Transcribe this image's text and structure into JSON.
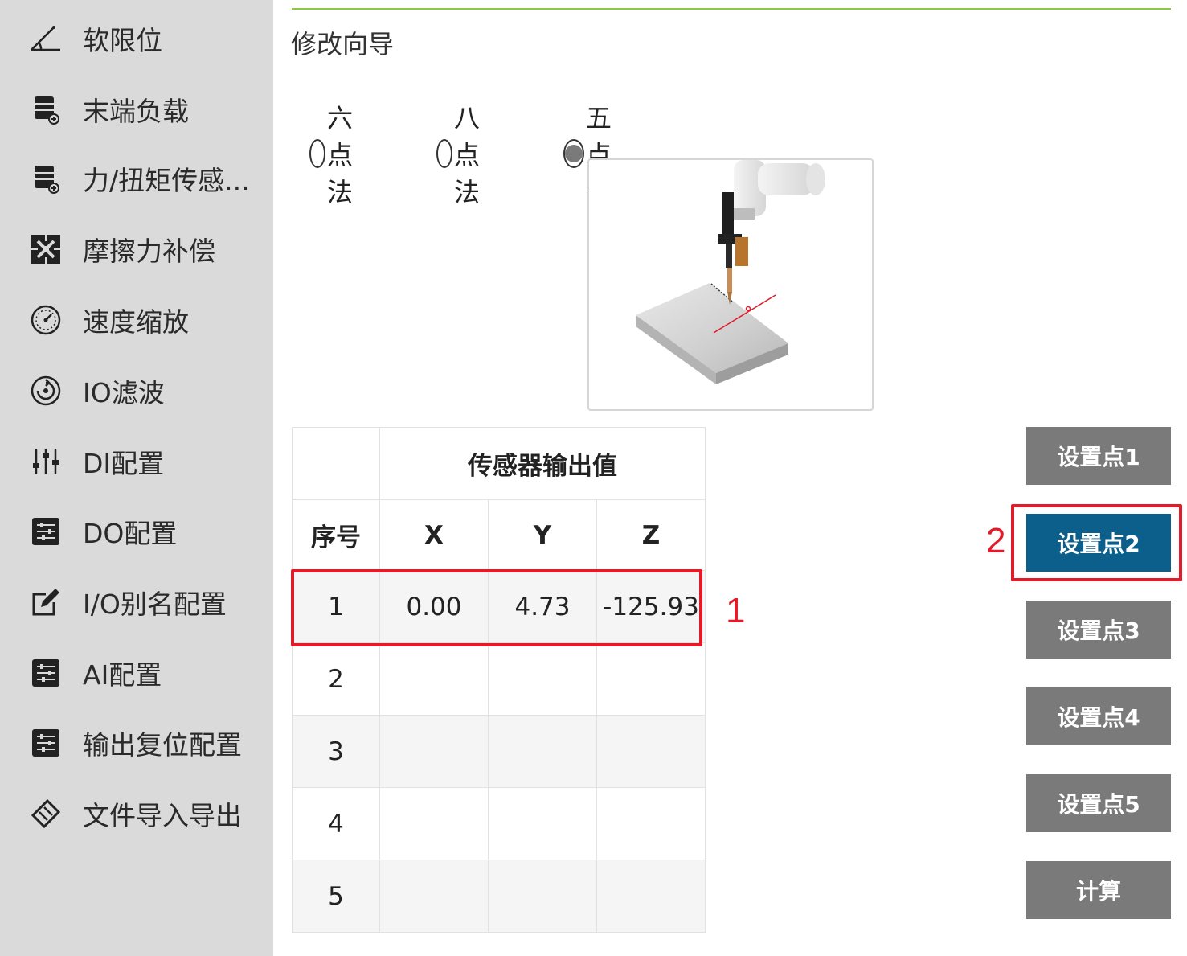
{
  "sidebar": {
    "items": [
      {
        "label": "软限位",
        "icon": "angle-icon"
      },
      {
        "label": "末端负载",
        "icon": "payload-icon"
      },
      {
        "label": "力/扭矩传感...",
        "icon": "sensor-icon"
      },
      {
        "label": "摩擦力补偿",
        "icon": "friction-icon"
      },
      {
        "label": "速度缩放",
        "icon": "speedometer-icon"
      },
      {
        "label": "IO滤波",
        "icon": "filter-icon"
      },
      {
        "label": "DI配置",
        "icon": "sliders-icon"
      },
      {
        "label": "DO配置",
        "icon": "settings-list-icon"
      },
      {
        "label": "I/O别名配置",
        "icon": "edit-icon"
      },
      {
        "label": "AI配置",
        "icon": "settings-list-icon"
      },
      {
        "label": "输出复位配置",
        "icon": "settings-list-icon"
      },
      {
        "label": "文件导入导出",
        "icon": "transfer-icon"
      }
    ]
  },
  "main": {
    "title": "修改向导",
    "radio_options": [
      {
        "label": "六点法",
        "selected": false
      },
      {
        "label": "八点法",
        "selected": false
      },
      {
        "label": "五点法",
        "selected": true
      }
    ],
    "table": {
      "group_header": "传感器输出值",
      "columns": [
        "序号",
        "X",
        "Y",
        "Z"
      ],
      "rows": [
        [
          "1",
          "0.00",
          "4.73",
          "-125.93"
        ],
        [
          "2",
          "",
          "",
          ""
        ],
        [
          "3",
          "",
          "",
          ""
        ],
        [
          "4",
          "",
          "",
          ""
        ],
        [
          "5",
          "",
          "",
          ""
        ]
      ]
    },
    "buttons": [
      "设置点1",
      "设置点2",
      "设置点3",
      "设置点4",
      "设置点5",
      "计算"
    ],
    "active_button": "设置点2",
    "annotations": [
      "1",
      "2"
    ]
  },
  "colors": {
    "sidebar_bg": "#dadada",
    "accent_line": "#8dc63f",
    "button_gray": "#7a7a7a",
    "button_active": "#0b5f8a",
    "annotation_red": "#e21b2a"
  }
}
